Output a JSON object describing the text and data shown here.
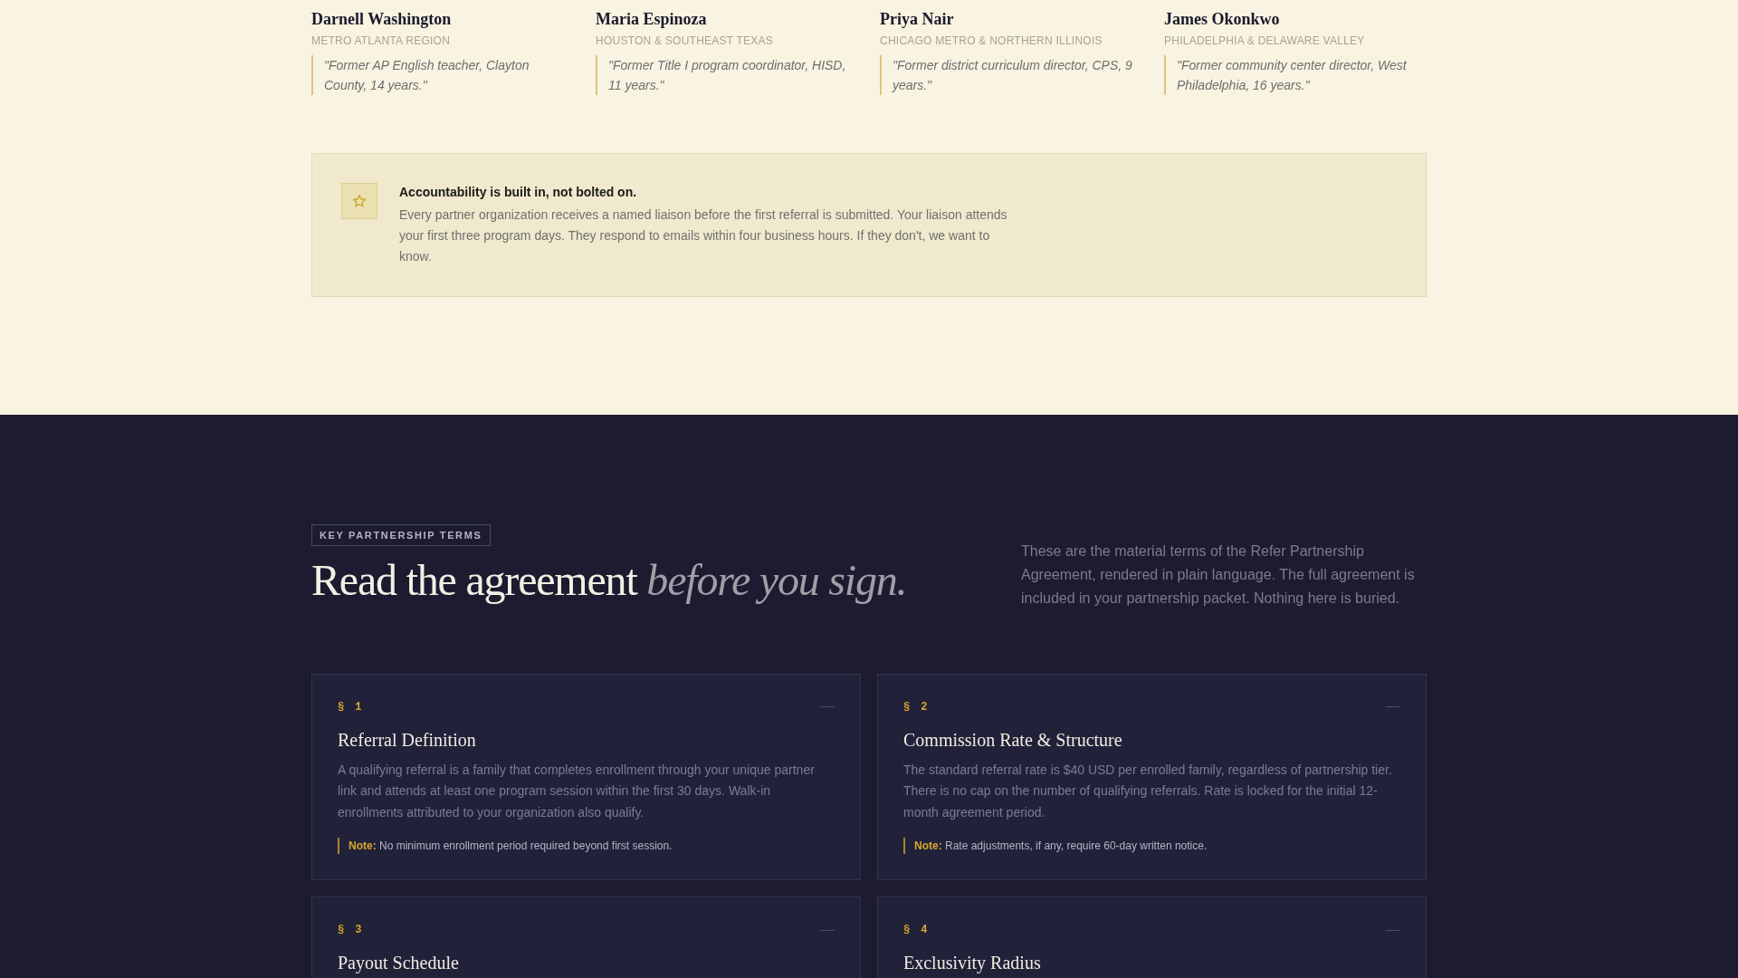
{
  "advisors": [
    {
      "name": "Darnell Washington",
      "region": "METRO ATLANTA REGION",
      "quote": "\"Former AP English teacher, Clayton County, 14 years.\""
    },
    {
      "name": "Maria Espinoza",
      "region": "HOUSTON & SOUTHEAST TEXAS",
      "quote": "\"Former Title I program coordinator, HISD, 11 years.\""
    },
    {
      "name": "Priya Nair",
      "region": "CHICAGO METRO & NORTHERN ILLINOIS",
      "quote": "\"Former district curriculum director, CPS, 9 years.\""
    },
    {
      "name": "James Okonkwo",
      "region": "PHILADELPHIA & DELAWARE VALLEY",
      "quote": "\"Former community center director, West Philadelphia, 16 years.\""
    }
  ],
  "callout": {
    "title": "Accountability is built in, not bolted on.",
    "body": "Every partner organization receives a named liaison before the first referral is submitted. Your liaison attends your first three program days. They respond to emails within four business hours. If they don't, we want to know."
  },
  "terms_section": {
    "badge": "KEY PARTNERSHIP TERMS",
    "heading": "Read the agreement *before you sign.*",
    "intro": "These are the material terms of the Refer Partnership Agreement, rendered in plain language. The full agreement is included in your partnership packet. Nothing here is buried."
  },
  "terms": [
    {
      "number": "§ 1",
      "title": "Referral Definition",
      "body": "A qualifying referral is a family that completes enrollment through your unique partner link and attends at least one program session within the first 30 days. Walk-in enrollments attributed to your organization also qualify.",
      "note": "**Note:** No minimum enrollment period required beyond first session."
    },
    {
      "number": "§ 2",
      "title": "Commission Rate & Structure",
      "body": "The standard referral rate is $40 USD per enrolled family, regardless of partnership tier. There is no cap on the number of qualifying referrals. Rate is locked for the initial 12-month agreement period.",
      "note": "**Note:** Rate adjustments, if any, require 60-day written notice."
    },
    {
      "number": "§ 3",
      "title": "Payout Schedule"
    },
    {
      "number": "§ 4",
      "title": "Exclusivity Radius"
    }
  ]
}
